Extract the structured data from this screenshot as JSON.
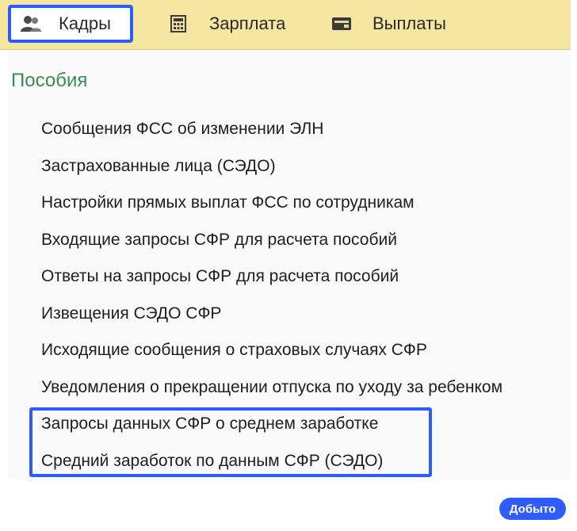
{
  "tabs": [
    {
      "label": "Кадры",
      "icon": "users-icon",
      "selected": true
    },
    {
      "label": "Зарплата",
      "icon": "calculator-icon",
      "selected": false
    },
    {
      "label": "Выплаты",
      "icon": "wallet-icon",
      "selected": false
    }
  ],
  "section": {
    "title": "Пособия",
    "items": [
      "Сообщения ФСС об изменении ЭЛН",
      "Застрахованные лица (СЭДО)",
      "Настройки прямых выплат ФСС по сотрудникам",
      "Входящие запросы СФР для расчета пособий",
      "Ответы на запросы СФР для расчета пособий",
      "Извещения СЭДО СФР",
      "Исходящие сообщения о страховых случаях СФР",
      "Уведомления о прекращении отпуска по уходу за ребенком",
      "Запросы данных СФР о среднем заработке",
      "Средний заработок по данным СФР (СЭДО)"
    ]
  },
  "watermark": {
    "label": "Добыто"
  },
  "colors": {
    "topbar": "#f5e6a0",
    "highlight": "#2f5cff",
    "section_title": "#3d8a55"
  }
}
